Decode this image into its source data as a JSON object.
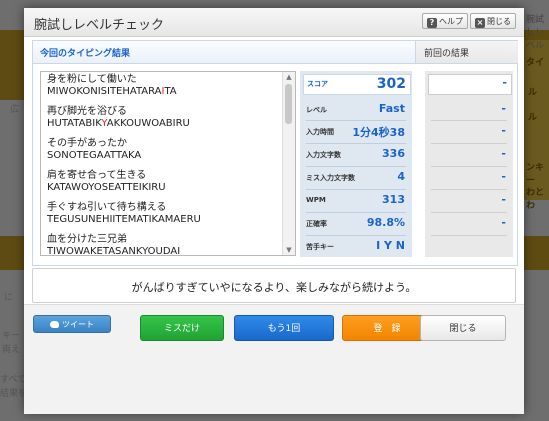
{
  "background": {
    "right_tabs": [
      "タイ",
      "ル",
      "ル",
      "ンキー",
      "わとわ"
    ],
    "top_right_label": "腕試しレベル",
    "left_texts": [
      "広",
      "に",
      "キー",
      "両え",
      "すべて",
      "結果を"
    ]
  },
  "dialog": {
    "title": "腕試しレベルチェック",
    "help_label": "ヘルプ",
    "close_label": "閉じる"
  },
  "results": {
    "current_heading": "今回のタイピング結果",
    "previous_heading": "前回の結果",
    "typed_list": [
      {
        "jp": "身を粉にして働いた",
        "ro_pre": "MIWOKONISITEHATARA",
        "ro_miss": "I",
        "ro_post": "TA"
      },
      {
        "jp": "再び脚光を浴びる",
        "ro_pre": "HUTATABIK",
        "ro_miss": "Y",
        "ro_post": "AKKOUWOABIRU"
      },
      {
        "jp": "その手があったか",
        "ro_pre": "SONOTEGAATTAKA",
        "ro_miss": "",
        "ro_post": ""
      },
      {
        "jp": "肩を寄せ合って生きる",
        "ro_pre": "KATAWOYOSEATTEIKIRU",
        "ro_miss": "",
        "ro_post": ""
      },
      {
        "jp": "手ぐすね引いて待ち構える",
        "ro_pre": "TEGUSUNEHIITEMATIKAMAERU",
        "ro_miss": "",
        "ro_post": ""
      },
      {
        "jp": "血を分けた三兄弟",
        "ro_pre": "TIWOWAKETASANKYOUDAI",
        "ro_miss": "",
        "ro_post": ""
      }
    ],
    "stats": [
      {
        "label": "スコア",
        "value": "302",
        "previous": "-"
      },
      {
        "label": "レベル",
        "value": "Fast",
        "previous": "-"
      },
      {
        "label": "入力時間",
        "value": "1分4秒38",
        "previous": "-"
      },
      {
        "label": "入力文字数",
        "value": "336",
        "previous": "-"
      },
      {
        "label": "ミス入力文字数",
        "value": "4",
        "previous": "-"
      },
      {
        "label": "WPM",
        "value": "313",
        "previous": "-"
      },
      {
        "label": "正確率",
        "value": "98.8%",
        "previous": "-"
      },
      {
        "label": "苦手キー",
        "value": "I Y N",
        "previous": ""
      }
    ]
  },
  "message": "がんばりすぎていやになるより、楽しみながら続けよう。",
  "buttons": {
    "tweet": "ツイート",
    "miss_only": "ミスだけ",
    "again": "もう1回",
    "register": "登　録",
    "close": "閉じる"
  },
  "colors": {
    "accent_blue": "#1a63c9",
    "miss_red": "#e0231d",
    "green": "#26b33b",
    "orange": "#f28c00"
  }
}
